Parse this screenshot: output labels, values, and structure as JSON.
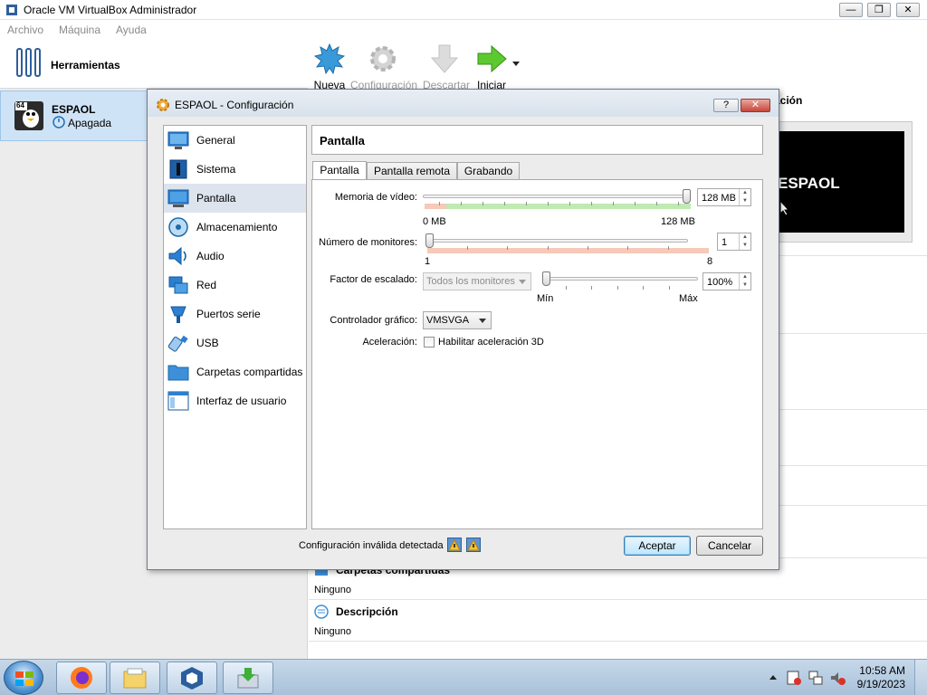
{
  "window": {
    "title": "Oracle VM VirtualBox Administrador",
    "minimize": "—",
    "maximize": "❐",
    "close": "✕"
  },
  "menu": [
    "Archivo",
    "Máquina",
    "Ayuda"
  ],
  "sidebar": {
    "tools_label": "Herramientas",
    "vm": {
      "name": "ESPAOL",
      "state": "Apagada",
      "badge": "64"
    }
  },
  "toolbar": {
    "items": [
      {
        "label": "Nueva",
        "enabled": true
      },
      {
        "label": "Configuración",
        "enabled": false
      },
      {
        "label": "Descartar",
        "enabled": false
      },
      {
        "label": "Iniciar",
        "enabled": true
      }
    ]
  },
  "details": {
    "preview_title": "zación",
    "preview_vm_name": "ESPAOL",
    "shared_folders_title": "Carpetas compartidas",
    "shared_folders_value": "Ninguno",
    "description_title": "Descripción",
    "description_value": "Ninguno"
  },
  "dialog": {
    "title": "ESPAOL - Configuración",
    "help": "?",
    "close": "✕",
    "categories": [
      {
        "label": "General",
        "icon": "general-icon"
      },
      {
        "label": "Sistema",
        "icon": "system-icon"
      },
      {
        "label": "Pantalla",
        "icon": "display-icon",
        "selected": true
      },
      {
        "label": "Almacenamiento",
        "icon": "storage-icon"
      },
      {
        "label": "Audio",
        "icon": "audio-icon"
      },
      {
        "label": "Red",
        "icon": "network-icon"
      },
      {
        "label": "Puertos serie",
        "icon": "serial-ports-icon"
      },
      {
        "label": "USB",
        "icon": "usb-icon"
      },
      {
        "label": "Carpetas compartidas",
        "icon": "shared-folders-icon"
      },
      {
        "label": "Interfaz de usuario",
        "icon": "user-interface-icon"
      }
    ],
    "page_title": "Pantalla",
    "tabs": [
      "Pantalla",
      "Pantalla remota",
      "Grabando"
    ],
    "active_tab": "Pantalla",
    "video_memory": {
      "label": "Memoria de vídeo:",
      "value": "128 MB",
      "min_label": "0 MB",
      "max_label": "128 MB",
      "fraction": 1.0
    },
    "monitors": {
      "label": "Número de monitores:",
      "value": "1",
      "min_label": "1",
      "max_label": "8",
      "fraction": 0.0
    },
    "scaling": {
      "label": "Factor de escalado:",
      "combo": "Todos los monitores",
      "value": "100%",
      "min_label": "Mín",
      "max_label": "Máx",
      "fraction": 0.0
    },
    "graphics_controller": {
      "label": "Controlador gráfico:",
      "value": "VMSVGA"
    },
    "acceleration": {
      "label": "Aceleración:",
      "checkbox_label": "Habilitar aceleración 3D",
      "checked": false
    },
    "status_message": "Configuración inválida detectada",
    "ok": "Aceptar",
    "cancel": "Cancelar"
  },
  "taskbar": {
    "time": "10:58 AM",
    "date": "9/19/2023"
  }
}
